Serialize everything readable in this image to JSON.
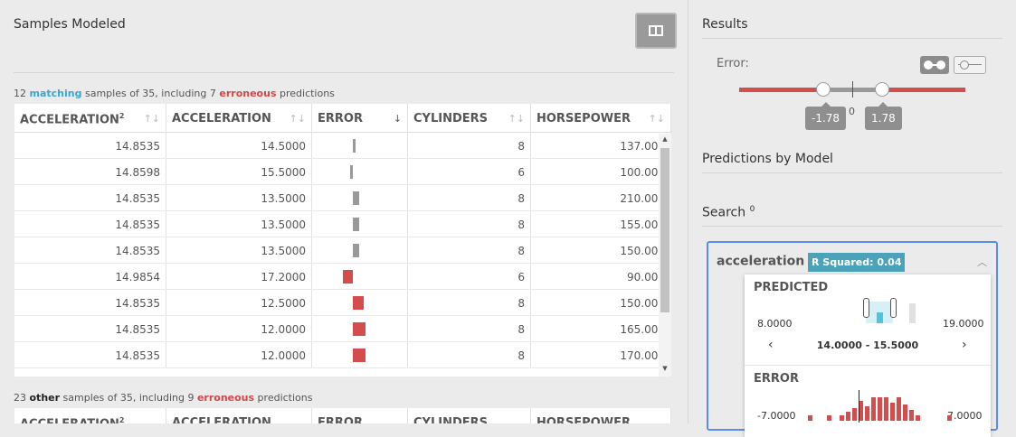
{
  "left": {
    "title": "Samples Modeled",
    "matching": {
      "prefix": "12 ",
      "keyword": "matching",
      "middle": " samples of 35, including 7 ",
      "err_keyword": "erroneous",
      "suffix": " predictions"
    },
    "other": {
      "prefix": "23 ",
      "keyword": "other",
      "middle": " samples of 35, including 9 ",
      "err_keyword": "erroneous",
      "suffix": " predictions"
    },
    "columns": [
      {
        "label": "ACCELERATION",
        "sup": "2"
      },
      {
        "label": "ACCELERATION",
        "sup": ""
      },
      {
        "label": "ERROR",
        "sup": ""
      },
      {
        "label": "CYLINDERS",
        "sup": ""
      },
      {
        "label": "HORSEPOWER",
        "sup": ""
      }
    ],
    "rows": [
      {
        "acc2": "14.8535",
        "acc": "14.5000",
        "error": -0.5,
        "cyl": "8",
        "hp": "137.000"
      },
      {
        "acc2": "14.8598",
        "acc": "15.5000",
        "error": 0.64,
        "cyl": "6",
        "hp": "100.000"
      },
      {
        "acc2": "14.8535",
        "acc": "13.5000",
        "error": -1.35,
        "cyl": "8",
        "hp": "210.000"
      },
      {
        "acc2": "14.8535",
        "acc": "13.5000",
        "error": -1.35,
        "cyl": "8",
        "hp": "155.000"
      },
      {
        "acc2": "14.8535",
        "acc": "13.5000",
        "error": -1.35,
        "cyl": "8",
        "hp": "150.000"
      },
      {
        "acc2": "14.9854",
        "acc": "17.2000",
        "error": 2.21,
        "cyl": "6",
        "hp": "90.000"
      },
      {
        "acc2": "14.8535",
        "acc": "12.5000",
        "error": -2.35,
        "cyl": "8",
        "hp": "150.000"
      },
      {
        "acc2": "14.8535",
        "acc": "12.0000",
        "error": -2.85,
        "cyl": "8",
        "hp": "165.000"
      },
      {
        "acc2": "14.8535",
        "acc": "12.0000",
        "error": -2.85,
        "cyl": "8",
        "hp": "170.000"
      }
    ]
  },
  "right": {
    "results_title": "Results",
    "error_label": "Error:",
    "low": "-1.78",
    "zero": "0",
    "high": "1.78",
    "predictions_title": "Predictions by Model",
    "search_title": "Search",
    "search_count": "0",
    "card": {
      "title": "acceleration",
      "count": "0",
      "r2": "R Squared: 0.04",
      "collapse_icon": "chevron-up-icon",
      "predicted": "PREDICTED",
      "pred_min": "8.0000",
      "pred_max": "19.0000",
      "pred_range": "14.0000 - 15.5000",
      "prev_icon": "chevron-left-icon",
      "next_icon": "chevron-right-icon",
      "error": "ERROR",
      "err_min": "-7.0000",
      "err_max": "7.0000"
    }
  },
  "colors": {
    "matching": "#3aa6d0",
    "erroneous": "#d04848",
    "error_bar": "#d44d4d",
    "ok_bar": "#999999",
    "accent": "#5a8ee6",
    "r2_badge": "#4aa3b8"
  }
}
